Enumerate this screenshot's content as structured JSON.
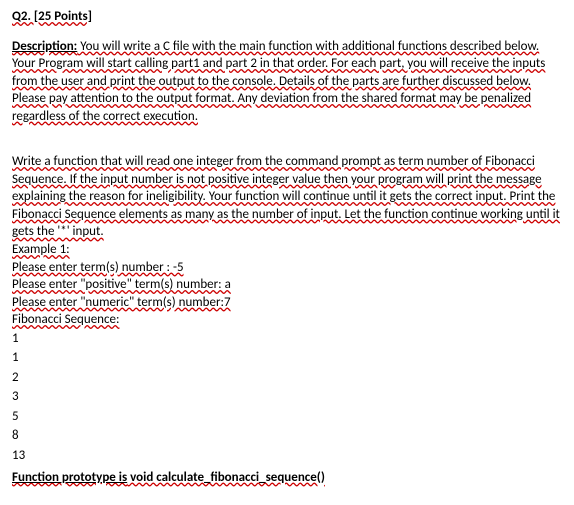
{
  "header": "Q2. [25 Points]",
  "descLabel": "Description:",
  "description": " You will write a C file with the main function with additional functions described below. Your Program will start calling part1 and part 2 in that order. For each part, you will receive the inputs from the user and print the output to the console. Details of the parts are further discussed below. Please pay attention to the output format. Any deviation from the shared format may be penalized regardless of the correct execution.",
  "instruction": " Write a function that will read one integer from the command prompt as term number of Fibonacci Sequence. If the input number is not positive integer value then your program will print the message explaining the reason for ineligibility. Your function will continue until it gets the correct input. Print the Fibonacci Sequence elements as many as the number of input. Let the function continue working until it gets the '*' input.",
  "example": {
    "title": "Example 1:",
    "line1": "Please enter term(s) number : -5",
    "line2": "Please enter \"positive\" term(s) number: a",
    "line3": "Please enter \"numeric\" term(s) number:7",
    "seqLabel": "Fibonacci Sequence:",
    "sequence": [
      "1",
      "1",
      "2",
      "3",
      "5",
      "8",
      "13"
    ]
  },
  "protoLabel": "Function prototype is",
  "protoValue": " void calculate_fibonacci_sequence()"
}
